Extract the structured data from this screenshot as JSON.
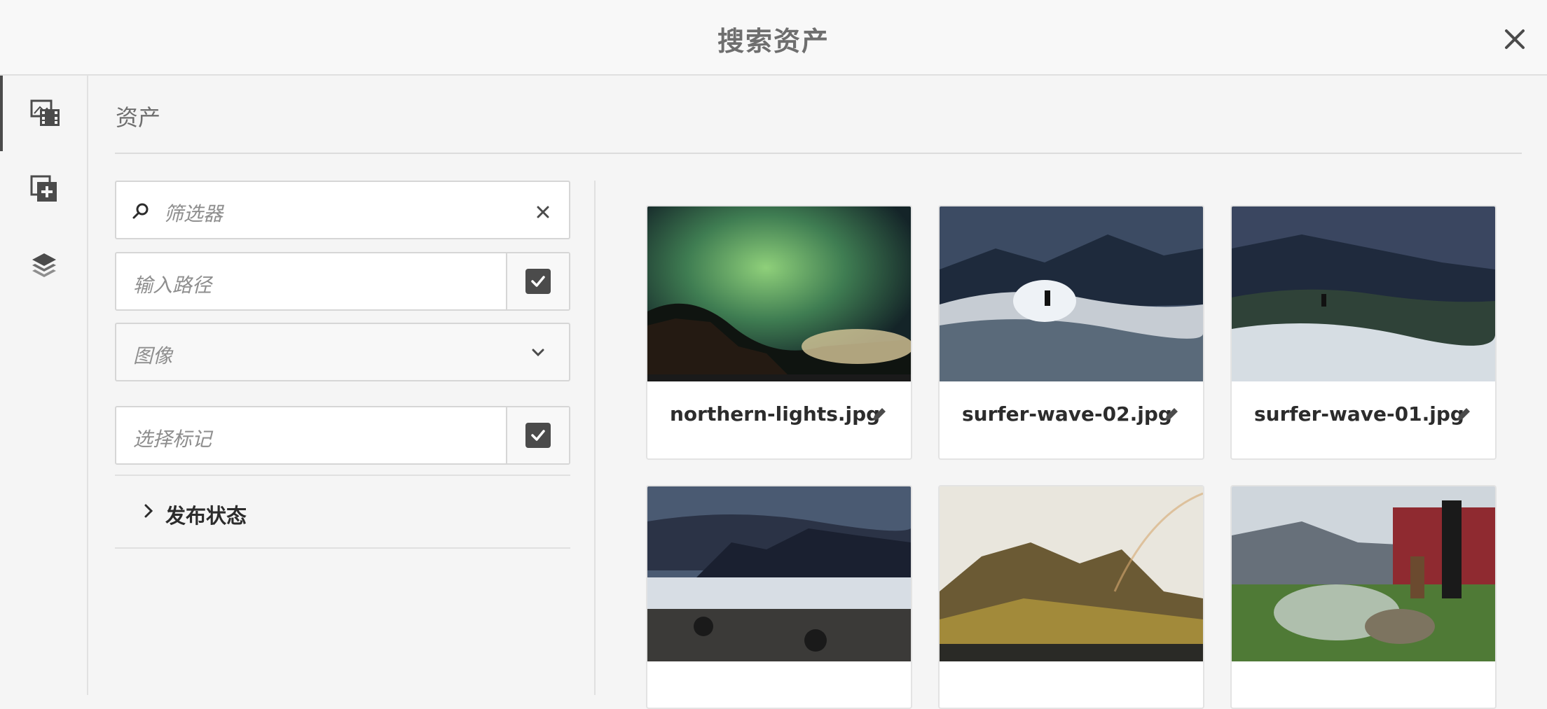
{
  "header": {
    "title": "搜索资产"
  },
  "rail": {
    "items": [
      {
        "icon": "assets-icon",
        "active": true
      },
      {
        "icon": "add-collection-icon",
        "active": false
      },
      {
        "icon": "layers-icon",
        "active": false
      }
    ]
  },
  "panel": {
    "title": "资产"
  },
  "filters": {
    "search_placeholder": "筛选器",
    "path_placeholder": "输入路径",
    "type_selected": "图像",
    "tags_placeholder": "选择标记",
    "publish_status_label": "发布状态"
  },
  "assets": [
    {
      "name": "northern-lights.jpg"
    },
    {
      "name": "surfer-wave-02.jpg"
    },
    {
      "name": "surfer-wave-01.jpg"
    },
    {
      "name": ""
    },
    {
      "name": ""
    },
    {
      "name": ""
    }
  ],
  "colors": {
    "accent": "#4b4b4b",
    "background": "#f5f5f5"
  }
}
